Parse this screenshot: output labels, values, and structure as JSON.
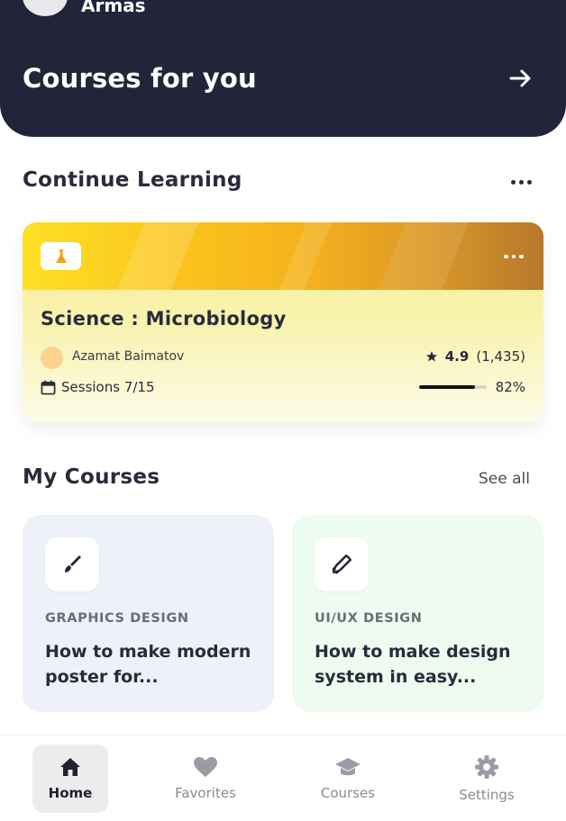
{
  "header": {
    "user_name": "Armas",
    "title": "Courses for you",
    "icons": {
      "bell": "bell-icon",
      "arrow": "arrow-right-icon"
    }
  },
  "continue_learning": {
    "title": "Continue Learning",
    "card": {
      "badge_icon": "flask-icon",
      "title": "Science : Microbiology",
      "instructor": "Azamat Baimatov",
      "rating": "4.9",
      "rating_count": "(1,435)",
      "sessions": "Sessions 7/15",
      "progress": 0.82,
      "progress_label": "82%"
    }
  },
  "my_courses": {
    "title": "My Courses",
    "see_all": "See all",
    "items": [
      {
        "icon": "brush-icon",
        "category": "GRAPHICS DESIGN",
        "title": "How to make modern poster for...",
        "bg": "#eef1f7"
      },
      {
        "icon": "design-tools-icon",
        "category": "UI/UX DESIGN",
        "title": "How to make design system in easy...",
        "bg": "#edfbf1"
      }
    ]
  },
  "nav": {
    "items": [
      {
        "label": "Home",
        "icon": "home-icon",
        "active": true
      },
      {
        "label": "Favorites",
        "icon": "heart-icon",
        "active": false
      },
      {
        "label": "Courses",
        "icon": "graduation-cap-icon",
        "active": false
      },
      {
        "label": "Settings",
        "icon": "gear-icon",
        "active": false
      }
    ]
  },
  "colors": {
    "header_bg": "#22243a",
    "nav_active_bg": "#ececee",
    "accent_yellow": "#fde024",
    "text_dark": "#2a2b3a"
  }
}
